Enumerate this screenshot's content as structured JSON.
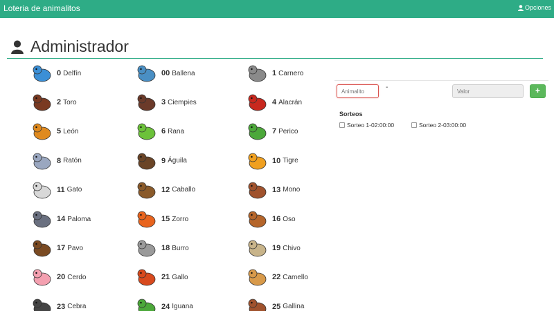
{
  "navbar": {
    "brand": "Loteria de animalitos",
    "options": "Opciones"
  },
  "page": {
    "title": "Administrador"
  },
  "animals": [
    {
      "num": "0",
      "name": "Delfín",
      "color": "#3b8fd6"
    },
    {
      "num": "00",
      "name": "Ballena",
      "color": "#4a8fc4"
    },
    {
      "num": "1",
      "name": "Carnero",
      "color": "#8a8a8a"
    },
    {
      "num": "2",
      "name": "Toro",
      "color": "#7a3a22"
    },
    {
      "num": "3",
      "name": "Ciempies",
      "color": "#6b3a2a"
    },
    {
      "num": "4",
      "name": "Alacrán",
      "color": "#c8281e"
    },
    {
      "num": "5",
      "name": "León",
      "color": "#e08a1e"
    },
    {
      "num": "6",
      "name": "Rana",
      "color": "#6cc23a"
    },
    {
      "num": "7",
      "name": "Perico",
      "color": "#4ca83a"
    },
    {
      "num": "8",
      "name": "Ratón",
      "color": "#9aa7c0"
    },
    {
      "num": "9",
      "name": "Águila",
      "color": "#6a4426"
    },
    {
      "num": "10",
      "name": "Tigre",
      "color": "#f0a020"
    },
    {
      "num": "11",
      "name": "Gato",
      "color": "#d8d8d8"
    },
    {
      "num": "12",
      "name": "Caballo",
      "color": "#8a5a2a"
    },
    {
      "num": "13",
      "name": "Mono",
      "color": "#a0522d"
    },
    {
      "num": "14",
      "name": "Paloma",
      "color": "#6a7080"
    },
    {
      "num": "15",
      "name": "Zorro",
      "color": "#e8641e"
    },
    {
      "num": "16",
      "name": "Oso",
      "color": "#b5652a"
    },
    {
      "num": "17",
      "name": "Pavo",
      "color": "#7a4a22"
    },
    {
      "num": "18",
      "name": "Burro",
      "color": "#9a9a9a"
    },
    {
      "num": "19",
      "name": "Chivo",
      "color": "#c8b48a"
    },
    {
      "num": "20",
      "name": "Cerdo",
      "color": "#f4a0b0"
    },
    {
      "num": "21",
      "name": "Gallo",
      "color": "#d84a1e"
    },
    {
      "num": "22",
      "name": "Camello",
      "color": "#d89a4a"
    },
    {
      "num": "23",
      "name": "Cebra",
      "color": "#444444"
    },
    {
      "num": "24",
      "name": "Iguana",
      "color": "#4ca83a"
    },
    {
      "num": "25",
      "name": "Gallina",
      "color": "#a0522d"
    }
  ],
  "form": {
    "animal_placeholder": "Animalito",
    "separator": "-",
    "valor_placeholder": "Valor",
    "add_label": "+"
  },
  "sorteos": {
    "title": "Sorteos",
    "items": [
      {
        "label": "Sorteo 1-02:00:00",
        "checked": false
      },
      {
        "label": "Sorteo 2-03:00:00",
        "checked": false
      }
    ]
  },
  "colors": {
    "primary": "#2eac86",
    "success": "#5cb85c",
    "error": "#d9534f"
  }
}
